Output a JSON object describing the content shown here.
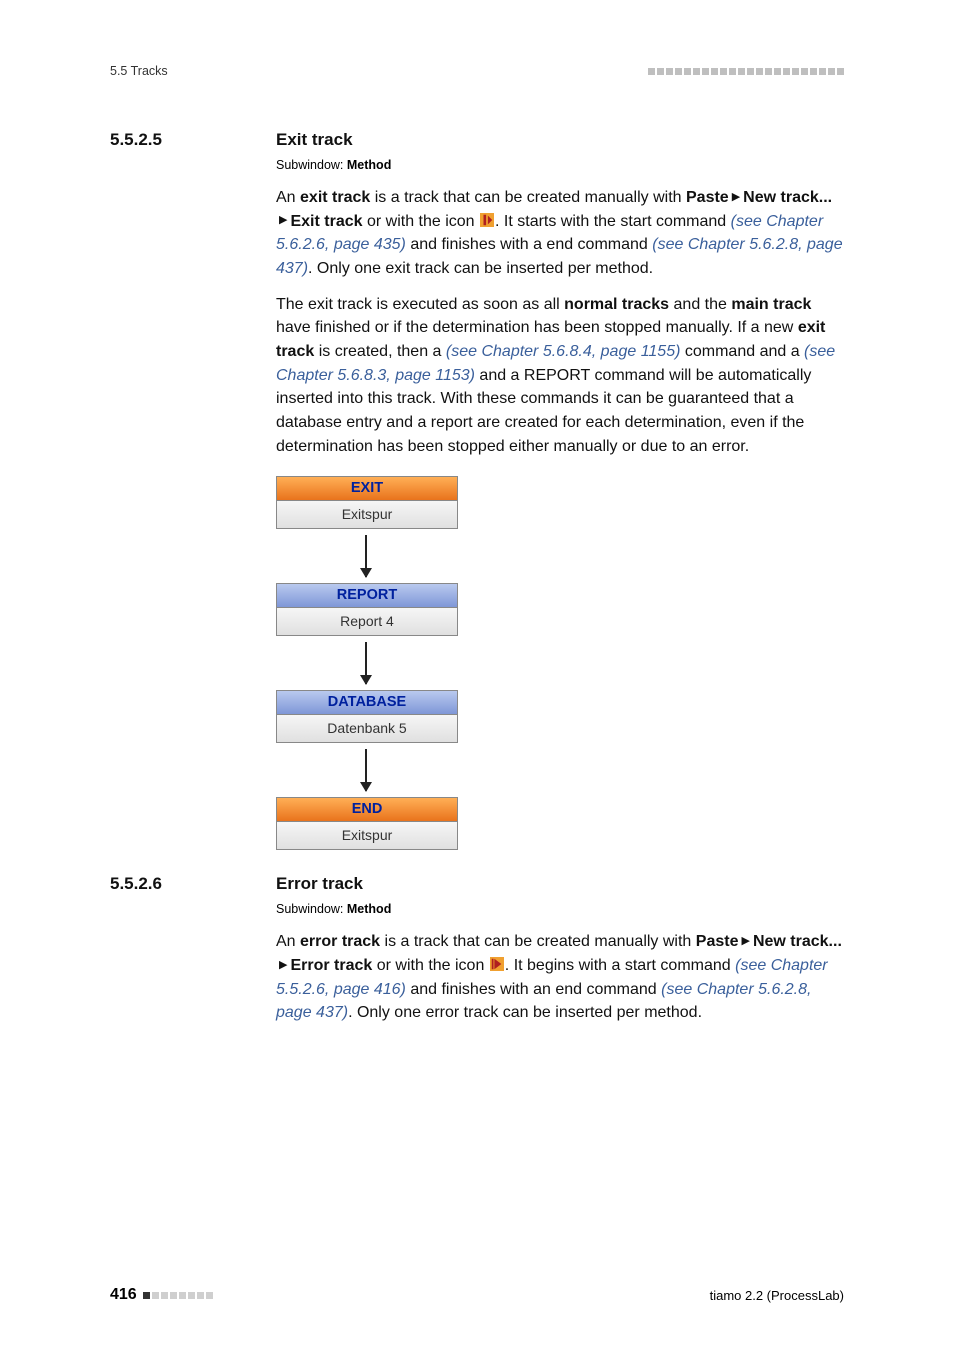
{
  "header": {
    "left": "5.5 Tracks"
  },
  "sec1": {
    "num": "5.5.2.5",
    "title": "Exit track",
    "subwindow_label": "Subwindow:",
    "subwindow_value": "Method",
    "p1a": "An ",
    "p1b": "exit track",
    "p1c": " is a track that can be created manually with ",
    "p1d": "Paste",
    "p1e": "New track...",
    "p1f": "Exit track",
    "p1g": " or with the icon ",
    "p1h": ". It starts with the start command ",
    "p1ref1": "(see Chapter 5.6.2.6, page 435)",
    "p1i": " and finishes with a end command ",
    "p1ref2": "(see Chapter 5.6.2.8, page 437)",
    "p1j": ". Only one exit track can be inserted per method.",
    "p2a": "The exit track is executed as soon as all ",
    "p2b": "normal tracks",
    "p2c": " and the ",
    "p2d": "main track",
    "p2e": " have finished or if the determination has been stopped manually. If a new ",
    "p2f": "exit track",
    "p2g": " is created, then a ",
    "p2ref1": "(see Chapter 5.6.8.4, page 1155)",
    "p2h": " command and a ",
    "p2ref2": "(see Chapter 5.6.8.3, page 1153)",
    "p2i": " and a REPORT command will be automatically inserted into this track. With these commands it can be guaranteed that a database entry and a report are created for each determination, even if the determination has been stopped either manually or due to an error."
  },
  "diagram": {
    "b1_head": "EXIT",
    "b1_body": "Exitspur",
    "b2_head": "REPORT",
    "b2_body": "Report 4",
    "b3_head": "DATABASE",
    "b3_body": "Datenbank 5",
    "b4_head": "END",
    "b4_body": "Exitspur"
  },
  "sec2": {
    "num": "5.5.2.6",
    "title": "Error track",
    "subwindow_label": "Subwindow:",
    "subwindow_value": "Method",
    "p1a": "An ",
    "p1b": "error track",
    "p1c": " is a track that can be created manually with ",
    "p1d": "Paste",
    "p1e": "New track...",
    "p1f": "Error track",
    "p1g": " or with the icon ",
    "p1h": ". It begins with a start command ",
    "p1ref1": "(see Chapter 5.5.2.6, page 416)",
    "p1i": " and finishes with an end command ",
    "p1ref2": "(see Chapter 5.6.2.8, page 437)",
    "p1j": ". Only one error track can be inserted per method."
  },
  "footer": {
    "page": "416",
    "right": "tiamo 2.2 (ProcessLab)"
  }
}
